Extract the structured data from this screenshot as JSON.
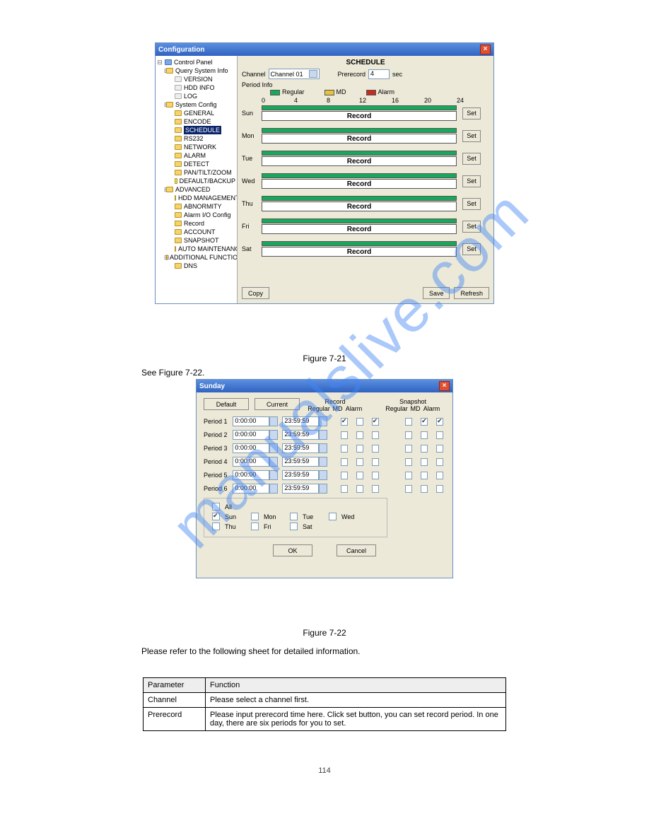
{
  "watermark": "manualslive.com",
  "config": {
    "title": "Configuration",
    "tree": {
      "root": "Control Panel",
      "groups": [
        {
          "name": "Query System Info",
          "children": [
            "VERSION",
            "HDD INFO",
            "LOG"
          ]
        },
        {
          "name": "System Config",
          "children": [
            "GENERAL",
            "ENCODE",
            "SCHEDULE",
            "RS232",
            "NETWORK",
            "ALARM",
            "DETECT",
            "PAN/TILT/ZOOM",
            "DEFAULT/BACKUP"
          ],
          "selected": "SCHEDULE"
        },
        {
          "name": "ADVANCED",
          "children": [
            "HDD MANAGEMENT",
            "ABNORMITY",
            "Alarm I/O Config",
            "Record",
            "ACCOUNT",
            "SNAPSHOT",
            "AUTO MAINTENANCE"
          ]
        },
        {
          "name": "ADDITIONAL FUNCTION",
          "children": [
            "DNS"
          ]
        }
      ]
    },
    "heading": "SCHEDULE",
    "channel_label": "Channel",
    "channel_value": "Channel 01",
    "prerecord_label": "Prerecord",
    "prerecord_value": "4",
    "prerecord_unit": "sec",
    "period_info": "Period Info",
    "legend": {
      "regular": "Regular",
      "md": "MD",
      "alarm": "Alarm"
    },
    "ticks": [
      "0",
      "4",
      "8",
      "12",
      "16",
      "20",
      "24"
    ],
    "days": [
      "Sun",
      "Mon",
      "Tue",
      "Wed",
      "Thu",
      "Fri",
      "Sat"
    ],
    "bar_label": "Record",
    "set_btn": "Set",
    "buttons": {
      "copy": "Copy",
      "save": "Save",
      "refresh": "Refresh"
    }
  },
  "fig1_caption": "Figure 7-21",
  "sunday_pretext": "See Figure 7-22.",
  "sunday": {
    "title": "Sunday",
    "default_btn": "Default",
    "current_btn": "Current",
    "group_record": "Record",
    "group_snapshot": "Snapshot",
    "subcols": [
      "Regular",
      "MD",
      "Alarm"
    ],
    "periods": [
      {
        "label": "Period 1",
        "start": "0:00:00",
        "end": "23:59:59",
        "rec": [
          true,
          false,
          true
        ],
        "snap": [
          false,
          true,
          true
        ]
      },
      {
        "label": "Period 2",
        "start": "0:00:00",
        "end": "23:59:59",
        "rec": [
          false,
          false,
          false
        ],
        "snap": [
          false,
          false,
          false
        ]
      },
      {
        "label": "Period 3",
        "start": "0:00:00",
        "end": "23:59:59",
        "rec": [
          false,
          false,
          false
        ],
        "snap": [
          false,
          false,
          false
        ]
      },
      {
        "label": "Period 4",
        "start": "0:00:00",
        "end": "23:59:59",
        "rec": [
          false,
          false,
          false
        ],
        "snap": [
          false,
          false,
          false
        ]
      },
      {
        "label": "Period 5",
        "start": "0:00:00",
        "end": "23:59:59",
        "rec": [
          false,
          false,
          false
        ],
        "snap": [
          false,
          false,
          false
        ]
      },
      {
        "label": "Period 6",
        "start": "0:00:00",
        "end": "23:59:59",
        "rec": [
          false,
          false,
          false
        ],
        "snap": [
          false,
          false,
          false
        ]
      }
    ],
    "all_label": "All",
    "days": [
      {
        "lbl": "Sun",
        "ck": true
      },
      {
        "lbl": "Mon",
        "ck": false
      },
      {
        "lbl": "Tue",
        "ck": false
      },
      {
        "lbl": "Wed",
        "ck": false
      },
      {
        "lbl": "Thu",
        "ck": false
      },
      {
        "lbl": "Fri",
        "ck": false
      },
      {
        "lbl": "Sat",
        "ck": false
      }
    ],
    "ok": "OK",
    "cancel": "Cancel"
  },
  "fig2_caption": "Figure 7-22",
  "table_pretext": "Please refer to the following sheet for detailed information.",
  "table": {
    "headers": [
      "Parameter",
      "Function"
    ],
    "rows": [
      [
        "Channel",
        "Please select a channel first."
      ],
      [
        "Prerecord",
        "Please input prerecord time here. Click set button, you can set record period. In one day, there are six periods for you to set."
      ]
    ]
  },
  "page_number": "114"
}
